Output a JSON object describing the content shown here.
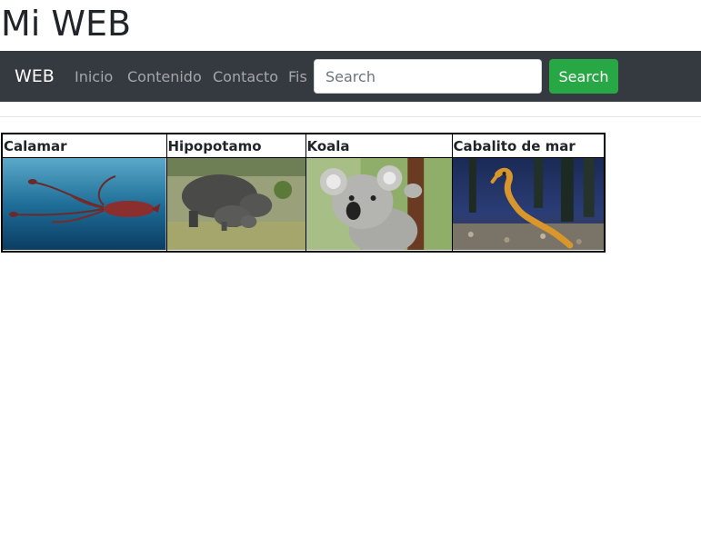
{
  "page": {
    "title": "Mi WEB"
  },
  "navbar": {
    "brand": "WEB",
    "links": [
      "Inicio",
      "Contenido",
      "Contacto",
      "Fis"
    ],
    "search": {
      "placeholder": "Search",
      "value": "",
      "button_label": "Search"
    },
    "colors": {
      "background": "#343a40",
      "button": "#28a745"
    }
  },
  "table": {
    "headers": [
      "Calamar",
      "Hipopotamo",
      "Koala",
      "Cabalito de mar"
    ],
    "images": [
      "squid-photo",
      "hippo-photo",
      "koala-photo",
      "seahorse-photo"
    ]
  }
}
